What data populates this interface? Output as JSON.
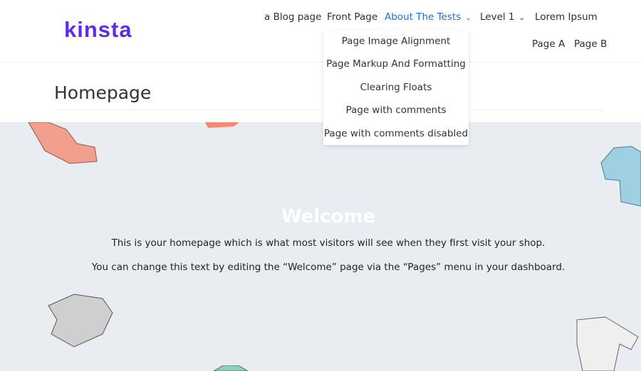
{
  "logo": "kinsta",
  "nav": {
    "items": [
      "a Blog page",
      "Front Page",
      "About The Tests",
      "Level 1",
      "Lorem Ipsum"
    ],
    "sub_items": [
      "Page A",
      "Page B"
    ]
  },
  "dropdown": [
    "Page Image Alignment",
    "Page Markup And Formatting",
    "Clearing Floats",
    "Page with comments",
    "Page with comments disabled"
  ],
  "page_title": "Homepage",
  "hero": {
    "title": "Welcome",
    "line1": "This is your homepage which is what most visitors will see when they first visit your shop.",
    "line2": "You can change this text by editing the “Welcome” page via the “Pages” menu in your dashboard."
  },
  "colors": {
    "brand": "#5b2ee8",
    "active": "#1a6ed8"
  }
}
